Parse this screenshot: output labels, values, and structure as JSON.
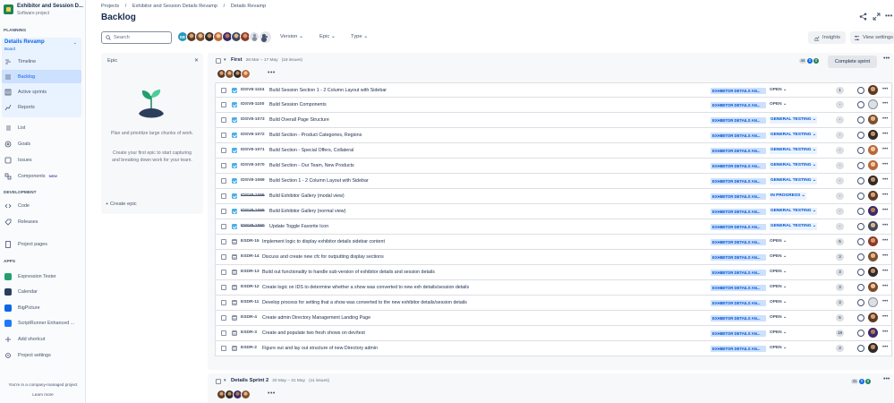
{
  "project": {
    "name": "Exhibitor and Session D...",
    "type": "Software project"
  },
  "sidebar": {
    "planning_heading": "PLANNING",
    "board_name": "Details Revamp",
    "board_sub": "Board",
    "planning_items": [
      {
        "label": "Timeline",
        "icon": "timeline-icon"
      },
      {
        "label": "Backlog",
        "icon": "backlog-icon"
      },
      {
        "label": "Active sprints",
        "icon": "sprint-board-icon"
      },
      {
        "label": "Reports",
        "icon": "reports-icon"
      }
    ],
    "items": [
      {
        "label": "List",
        "icon": "list-icon"
      },
      {
        "label": "Goals",
        "icon": "goals-icon"
      },
      {
        "label": "Issues",
        "icon": "issues-icon"
      },
      {
        "label": "Components",
        "icon": "components-icon",
        "badge": "NEW"
      }
    ],
    "development_heading": "DEVELOPMENT",
    "dev_items": [
      {
        "label": "Code",
        "icon": "code-icon"
      },
      {
        "label": "Releases",
        "icon": "releases-icon"
      }
    ],
    "project_pages": "Project pages",
    "apps_heading": "APPS",
    "app_items": [
      {
        "label": "Expression Tester",
        "icon": "expression-tester-icon"
      },
      {
        "label": "Calendar",
        "icon": "calendar-icon"
      },
      {
        "label": "BigPicture",
        "icon": "bigpicture-icon"
      },
      {
        "label": "ScriptRunner Enhanced ...",
        "icon": "scriptrunner-icon"
      },
      {
        "label": "Add shortcut",
        "icon": "add-shortcut-icon"
      },
      {
        "label": "Project settings",
        "icon": "settings-icon"
      }
    ],
    "footer_text": "You're in a company-managed project",
    "footer_link": "Learn more"
  },
  "breadcrumb": [
    "Projects",
    "/",
    "Exhibitor and Session Details Revamp",
    "/",
    "Details Revamp"
  ],
  "page_title": "Backlog",
  "toolbar": {
    "search_placeholder": "Search",
    "avatar_initials": "EB",
    "filters": [
      "Version",
      "Epic",
      "Type"
    ],
    "insights": "Insights",
    "view_settings": "View settings"
  },
  "epic_panel": {
    "title": "Epic",
    "desc1": "Plan and prioritize large chunks of work.",
    "desc2": "Create your first epic to start capturing and breaking down work for your team.",
    "create": "+ Create epic"
  },
  "sprints": [
    {
      "name": "First",
      "dates": "28 Mar – 17 May",
      "count": "(18 issues)",
      "counts": [
        "44",
        "0",
        "0"
      ],
      "action": "Complete sprint"
    },
    {
      "name": "Details Sprint 2",
      "dates": "20 May – 31 May",
      "count": "(11 issues)",
      "counts": [
        "31",
        "0",
        "0"
      ]
    }
  ],
  "issues": [
    {
      "type": "task",
      "key": "IDSV8-1104",
      "done": false,
      "summary": "Build Session Section 1 - 2 Column Layout with Sidebar",
      "epic": "EXHIBITOR DETAILS AN...",
      "status": "OPEN",
      "scls": "open",
      "points": "1",
      "face": "face1"
    },
    {
      "type": "task",
      "key": "IDSV8-1100",
      "done": false,
      "summary": "Build Session Components",
      "epic": "EXHIBITOR DETAILS AN...",
      "status": "OPEN",
      "scls": "open",
      "points": "-",
      "face": "blank"
    },
    {
      "type": "task",
      "key": "IDSV8-1073",
      "done": false,
      "summary": "Build Overall Page Structure",
      "epic": "EXHIBITOR DETAILS AN...",
      "status": "GENERAL TESTING",
      "scls": "test",
      "points": "-",
      "face": "face2"
    },
    {
      "type": "task",
      "key": "IDSV8-1072",
      "done": false,
      "summary": "Build Section - Product Categories, Regions",
      "epic": "EXHIBITOR DETAILS AN...",
      "status": "GENERAL TESTING",
      "scls": "test",
      "points": "-",
      "face": "face3"
    },
    {
      "type": "task",
      "key": "IDSV8-1071",
      "done": false,
      "summary": "Build Section - Special Offers, Collateral",
      "epic": "EXHIBITOR DETAILS AN...",
      "status": "GENERAL TESTING",
      "scls": "test",
      "points": "-",
      "face": "face4"
    },
    {
      "type": "task",
      "key": "IDSV8-1070",
      "done": false,
      "summary": "Build Section - Our Team, New Products",
      "epic": "EXHIBITOR DETAILS AN...",
      "status": "GENERAL TESTING",
      "scls": "test",
      "points": "-",
      "face": "face4"
    },
    {
      "type": "task",
      "key": "IDSV8-1069",
      "done": false,
      "summary": "Build Section 1 - 2 Column Layout with Sidebar",
      "epic": "EXHIBITOR DETAILS AN...",
      "status": "GENERAL TESTING",
      "scls": "test",
      "points": "-",
      "face": "face3"
    },
    {
      "type": "task",
      "key": "IDSV8-1066",
      "done": true,
      "summary": "Build Exhibitor Gallery (modal view)",
      "epic": "EXHIBITOR DETAILS AN...",
      "status": "IN PROGRESS",
      "scls": "prog",
      "points": "-",
      "face": "face1"
    },
    {
      "type": "task",
      "key": "IDSV8-1065",
      "done": true,
      "summary": "Build Exhibitor Gallery (normal view)",
      "epic": "EXHIBITOR DETAILS AN...",
      "status": "GENERAL TESTING",
      "scls": "test",
      "points": "-",
      "face": "face5"
    },
    {
      "type": "task",
      "key": "IDSV8-1060",
      "done": true,
      "summary": "Update Toggle Favorite Icon",
      "epic": "EXHIBITOR DETAILS AN...",
      "status": "GENERAL TESTING",
      "scls": "test",
      "points": "-",
      "face": "face6"
    },
    {
      "type": "story",
      "key": "ESDR-15",
      "done": false,
      "summary": "Implement logic to display exhibitor details sidebar content",
      "epic": "EXHIBITOR DETAILS AN...",
      "status": "OPEN",
      "scls": "open",
      "points": "5",
      "face": "face7"
    },
    {
      "type": "story",
      "key": "ESDR-14",
      "done": false,
      "summary": "Discuss and create new cfc for outputting display sections",
      "epic": "EXHIBITOR DETAILS AN...",
      "status": "OPEN",
      "scls": "open",
      "points": "3",
      "face": "face2"
    },
    {
      "type": "story",
      "key": "ESDR-13",
      "done": false,
      "summary": "Build out functionality to handle sub-version of exhibitor details and session details",
      "epic": "EXHIBITOR DETAILS AN...",
      "status": "OPEN",
      "scls": "open",
      "points": "3",
      "face": "face3"
    },
    {
      "type": "story",
      "key": "ESDR-12",
      "done": false,
      "summary": "Create logic on IDS to determine whether a show was converted to new exh details/session details",
      "epic": "EXHIBITOR DETAILS AN...",
      "status": "OPEN",
      "scls": "open",
      "points": "3",
      "face": "face8"
    },
    {
      "type": "story",
      "key": "ESDR-11",
      "done": false,
      "summary": "Develop process for setting that a show was converted to the new exhibitor details/session details",
      "epic": "EXHIBITOR DETAILS AN...",
      "status": "OPEN",
      "scls": "open",
      "points": "3",
      "face": "blank"
    },
    {
      "type": "story",
      "key": "ESDR-4",
      "done": false,
      "summary": "Create admin Directory Management Landing Page",
      "epic": "EXHIBITOR DETAILS AN...",
      "status": "OPEN",
      "scls": "open",
      "points": "5",
      "face": "face1"
    },
    {
      "type": "story",
      "key": "ESDR-3",
      "done": false,
      "summary": "Create and populate two fresh shows on dev/test",
      "epic": "EXHIBITOR DETAILS AN...",
      "status": "OPEN",
      "scls": "open",
      "points": "18",
      "face": "face5"
    },
    {
      "type": "story",
      "key": "ESDR-2",
      "done": false,
      "summary": "Figure out and lay out structure of new Directory admin",
      "epic": "EXHIBITOR DETAILS AN...",
      "status": "OPEN",
      "scls": "open",
      "points": "3",
      "face": "face3"
    }
  ]
}
